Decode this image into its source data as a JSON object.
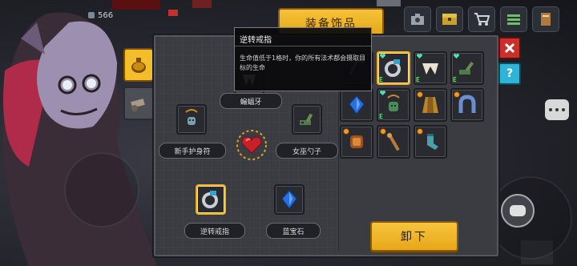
{
  "hud": {
    "coin_count": "566"
  },
  "title_tab": "装备饰品",
  "tooltip": {
    "title": "逆转戒指",
    "description": "生命值低于1格时，你的所有法术都会摄取目标的生命"
  },
  "equipped": {
    "top_label": "蝙蝠牙",
    "left_label": "新手护身符",
    "right_label": "女巫勺子",
    "bottom_left_label": "逆转戒指",
    "bottom_right_label": "蓝宝石"
  },
  "inventory_items": [
    {
      "name": "ring-of-reversal",
      "mark": "e"
    },
    {
      "name": "bat-fang",
      "mark": "e"
    },
    {
      "name": "witch-spoon",
      "mark": "e"
    },
    {
      "name": "sapphire",
      "mark": ""
    },
    {
      "name": "beginner-amulet",
      "mark": "e"
    },
    {
      "name": "cape",
      "mark": ""
    },
    {
      "name": "horseshoe",
      "mark": ""
    },
    {
      "name": "bracelet",
      "mark": ""
    },
    {
      "name": "wooden-staff",
      "mark": ""
    },
    {
      "name": "sock",
      "mark": ""
    }
  ],
  "buttons": {
    "unequip": "卸下",
    "help": "?"
  },
  "colors": {
    "accent_gold": "#f0b323",
    "panel": "#3b3c42",
    "close_red": "#c9302c",
    "help_blue": "#2fb4d8"
  }
}
